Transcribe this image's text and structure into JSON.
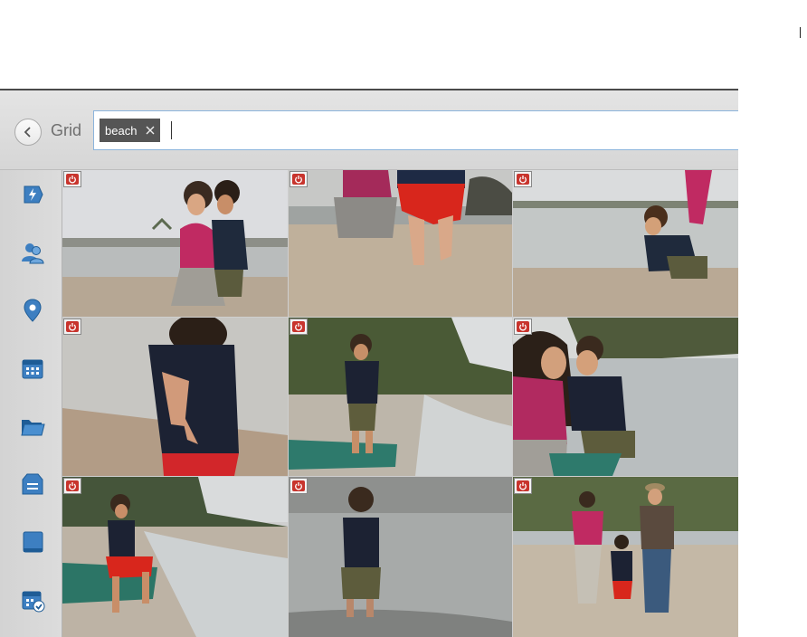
{
  "header": {
    "view_label": "Grid",
    "search": {
      "tags": [
        {
          "label": "beach"
        }
      ],
      "value": ""
    }
  },
  "sidebar": {
    "items": [
      {
        "icon": "instant-fix-icon"
      },
      {
        "icon": "people-icon"
      },
      {
        "icon": "places-pin-icon"
      },
      {
        "icon": "events-calendar-icon"
      },
      {
        "icon": "folders-icon"
      },
      {
        "icon": "tags-icon"
      },
      {
        "icon": "albums-book-icon"
      },
      {
        "icon": "scheduled-events-icon"
      }
    ]
  },
  "grid": {
    "columns": 3,
    "rows": 3,
    "photos": [
      {
        "subject": "mother-and-child-crouching-on-beach",
        "badge": "power-icon"
      },
      {
        "subject": "child-feet-on-sand",
        "badge": "power-icon"
      },
      {
        "subject": "child-crouching-at-water-edge",
        "badge": "power-icon"
      },
      {
        "subject": "child-closeup-dark-shirt",
        "badge": "power-icon"
      },
      {
        "subject": "child-standing-near-kayak",
        "badge": "power-icon"
      },
      {
        "subject": "mother-and-child-by-shore",
        "badge": "power-icon"
      },
      {
        "subject": "child-on-kayak",
        "badge": "power-icon"
      },
      {
        "subject": "child-walking-in-water",
        "badge": "power-icon"
      },
      {
        "subject": "family-walking-on-beach",
        "badge": "power-icon"
      }
    ]
  },
  "colors": {
    "accent": "#3d7fc1",
    "tag_bg": "#555555",
    "badge_red": "#c8342d"
  }
}
